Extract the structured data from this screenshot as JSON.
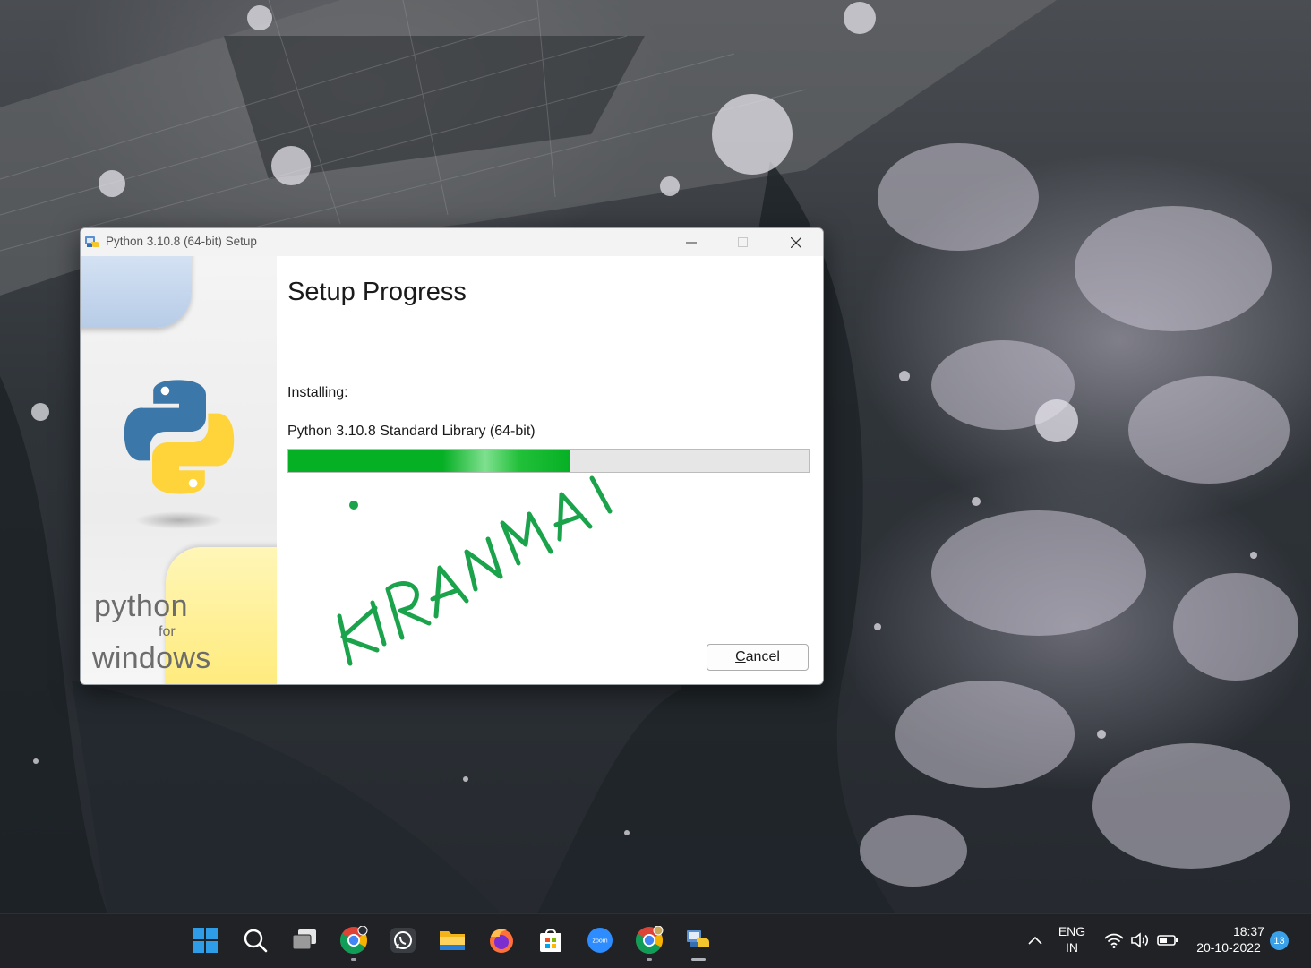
{
  "window": {
    "title": "Python 3.10.8 (64-bit) Setup"
  },
  "side_panel": {
    "brand_line1": "python",
    "brand_line2": "for",
    "brand_line3": "windows"
  },
  "content": {
    "heading": "Setup Progress",
    "status_label": "Installing:",
    "status_item": "Python 3.10.8 Standard Library (64-bit)",
    "progress_fraction": 0.54,
    "cancel_label_rest": "ancel",
    "cancel_label_accel": "C",
    "signature": "KIRANMAI"
  },
  "colors": {
    "progress_green": "#06b025",
    "signature_green": "#1aa34a",
    "taskbar_bg": "#202225"
  },
  "taskbar": {
    "apps": [
      {
        "name": "windows-start-icon"
      },
      {
        "name": "search-icon"
      },
      {
        "name": "task-view-icon"
      },
      {
        "name": "chrome-icon"
      },
      {
        "name": "whatsapp-icon"
      },
      {
        "name": "file-explorer-icon"
      },
      {
        "name": "firefox-icon"
      },
      {
        "name": "microsoft-store-icon"
      },
      {
        "name": "zoom-icon",
        "label": "zoom"
      },
      {
        "name": "chrome-profile-icon"
      },
      {
        "name": "python-setup-icon"
      }
    ]
  },
  "tray": {
    "lang_line1": "ENG",
    "lang_line2": "IN",
    "time": "18:37",
    "date": "20-10-2022",
    "notification_count": "13"
  }
}
